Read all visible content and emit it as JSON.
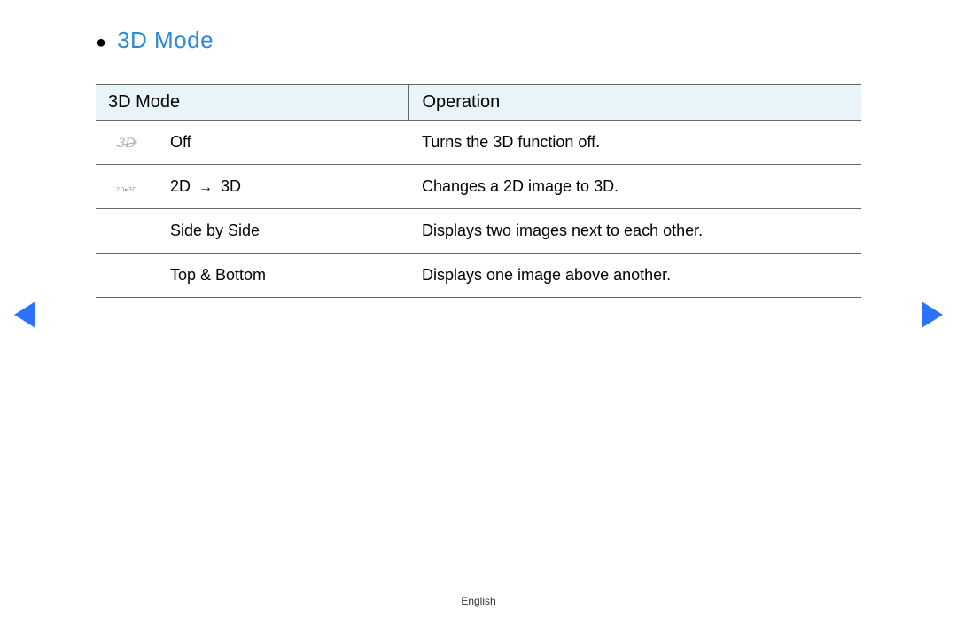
{
  "heading": {
    "bullet": "●",
    "title": "3D Mode",
    "title_suffix": ""
  },
  "notes": [
    {
      "bullet": "",
      "lines": [
        "",
        "",
        ""
      ]
    },
    {
      "bullet": "",
      "lines": [
        ""
      ]
    }
  ],
  "table": {
    "headers": {
      "mode": "3D Mode",
      "operation": "Operation"
    },
    "rows": [
      {
        "icon_type": "off",
        "mode_label": "Off",
        "operation": "Turns the 3D function off."
      },
      {
        "icon_type": "2d3d",
        "mode_label_parts": [
          "2D",
          "3D"
        ],
        "operation_parts": [
          "Changes a 2D image to 3D.",
          ""
        ]
      },
      {
        "icon_type": "none",
        "mode_label": "Side by Side",
        "operation": "Displays two images next to each other."
      },
      {
        "icon_type": "none",
        "mode_label": "Top & Bottom",
        "operation": "Displays one image above another."
      }
    ]
  },
  "footer": {
    "language": "English"
  }
}
